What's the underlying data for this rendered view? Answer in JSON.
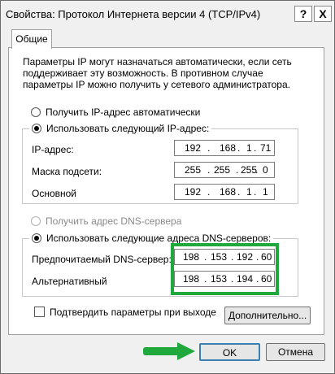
{
  "window": {
    "title": "Свойства: Протокол Интернета версии 4 (TCP/IPv4)",
    "help_label": "?",
    "close_label": "X"
  },
  "tab": {
    "label": "Общие"
  },
  "description": "Параметры IP могут назначаться автоматически, если сеть поддерживает эту возможность. В противном случае параметры IP можно получить у сетевого администратора.",
  "ip": {
    "auto_label": "Получить IP-адрес автоматически",
    "manual_label": "Использовать следующий IP-адрес:",
    "selected": "manual",
    "fields": [
      {
        "label": "IP-адрес:",
        "octets": [
          "192",
          "168",
          "1",
          "71"
        ]
      },
      {
        "label": "Маска подсети:",
        "octets": [
          "255",
          "255",
          "255",
          "0"
        ]
      },
      {
        "label": "Основной",
        "octets": [
          "192",
          "168",
          "1",
          "1"
        ]
      }
    ]
  },
  "dns": {
    "auto_label": "Получить адрес DNS-сервера",
    "manual_label": "Использовать следующие адреса DNS-серверов:",
    "selected": "manual",
    "fields": [
      {
        "label": "Предпочитаемый DNS-сервер:",
        "octets": [
          "198",
          "153",
          "192",
          "60"
        ]
      },
      {
        "label": "Альтернативный",
        "octets": [
          "198",
          "153",
          "194",
          "60"
        ]
      }
    ]
  },
  "validate_label": "Подтвердить параметры при выходе",
  "validate_checked": false,
  "advanced_label": "Дополнительно...",
  "ok_label": "OK",
  "cancel_label": "Отмена",
  "colors": {
    "highlight": "#1fa83b",
    "arrow": "#1fa83b"
  }
}
